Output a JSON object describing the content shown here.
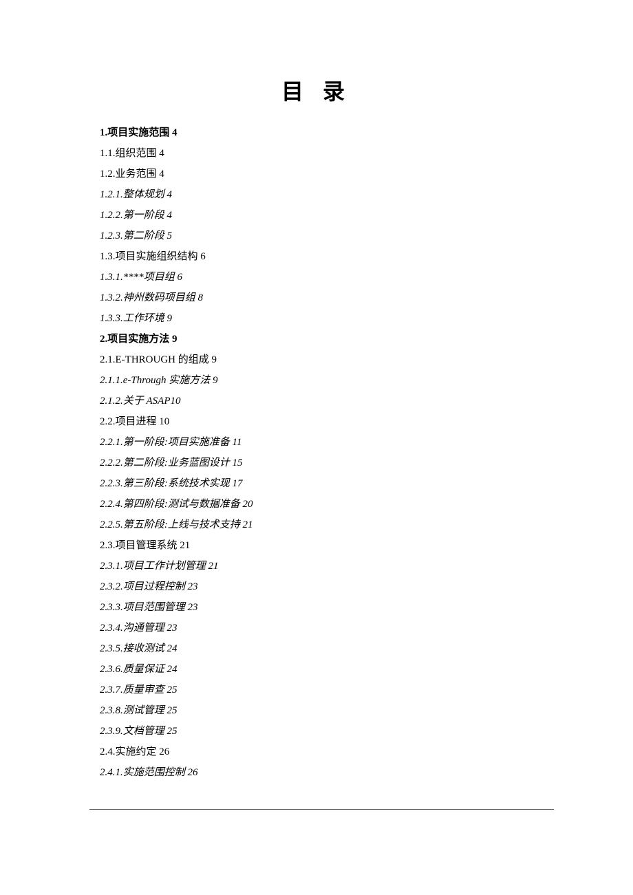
{
  "title": "目 录",
  "entries": [
    {
      "style": "bold",
      "text": "1.项目实施范围 4"
    },
    {
      "style": "normal",
      "text": "1.1.组织范围 4"
    },
    {
      "style": "normal",
      "text": "1.2.业务范围 4"
    },
    {
      "style": "italic",
      "text": "1.2.1.整体规划 4"
    },
    {
      "style": "italic",
      "text": "1.2.2.第一阶段 4"
    },
    {
      "style": "italic",
      "text": "1.2.3.第二阶段 5"
    },
    {
      "style": "normal",
      "text": "1.3.项目实施组织结构 6"
    },
    {
      "style": "italic",
      "text": "1.3.1.****项目组 6"
    },
    {
      "style": "italic",
      "text": "1.3.2.神州数码项目组 8"
    },
    {
      "style": "italic",
      "text": "1.3.3.工作环境 9"
    },
    {
      "style": "bold",
      "text": "2.项目实施方法 9"
    },
    {
      "style": "normal",
      "text": "2.1.E-THROUGH 的组成 9"
    },
    {
      "style": "italic",
      "text": "2.1.1.e-Through 实施方法 9"
    },
    {
      "style": "italic",
      "text": "2.1.2.关于 ASAP10"
    },
    {
      "style": "normal",
      "text": "2.2.项目进程 10"
    },
    {
      "style": "italic",
      "text": "2.2.1.第一阶段:项目实施准备 11"
    },
    {
      "style": "italic",
      "text": "2.2.2.第二阶段:业务蓝图设计 15"
    },
    {
      "style": "italic",
      "text": "2.2.3.第三阶段:系统技术实现 17"
    },
    {
      "style": "italic",
      "text": "2.2.4.第四阶段:测试与数据准备 20"
    },
    {
      "style": "italic",
      "text": "2.2.5.第五阶段:上线与技术支持 21"
    },
    {
      "style": "normal",
      "text": "2.3.项目管理系统 21"
    },
    {
      "style": "italic",
      "text": "2.3.1.项目工作计划管理 21"
    },
    {
      "style": "italic",
      "text": "2.3.2.项目过程控制 23"
    },
    {
      "style": "italic",
      "text": "2.3.3.项目范围管理 23"
    },
    {
      "style": "italic",
      "text": "2.3.4.沟通管理 23"
    },
    {
      "style": "italic",
      "text": "2.3.5.接收测试 24"
    },
    {
      "style": "italic",
      "text": "2.3.6.质量保证 24"
    },
    {
      "style": "italic",
      "text": "2.3.7.质量审查 25"
    },
    {
      "style": "italic",
      "text": "2.3.8.测试管理 25"
    },
    {
      "style": "italic",
      "text": "2.3.9.文档管理 25"
    },
    {
      "style": "normal",
      "text": "2.4.实施约定 26"
    },
    {
      "style": "italic",
      "text": "2.4.1.实施范围控制 26"
    }
  ]
}
